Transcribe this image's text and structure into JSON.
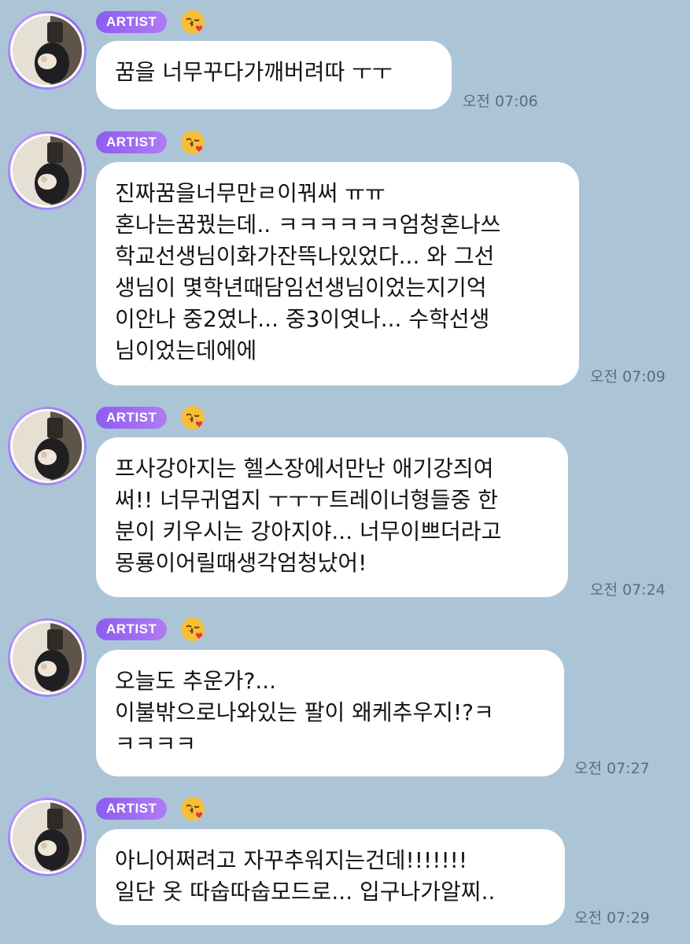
{
  "badge_label": "ARTIST",
  "emoji": "kissing-wink-heart",
  "messages": [
    {
      "text": "꿈을 너무꾸다가깨버려따 ㅜㅜ",
      "time": "오전 07:06"
    },
    {
      "text": "진짜꿈을너무만ㄹ이꿔써 ㅠㅠ\n혼나는꿈꿨는데.. ㅋㅋㅋㅋㅋㅋ엄청혼나쓰\n학교선생님이화가잔뜩나있었다... 와 그선\n생님이 몇학년때담임선생님이었는지기억\n이안나 중2였나... 중3이엿나... 수학선생\n님이었는데에에",
      "time": "오전 07:09"
    },
    {
      "text": "프사강아지는 헬스장에서만난 애기강즤여\n써!! 너무귀엽지 ㅜㅜㅜ트레이너형들중 한\n분이 키우시는 강아지야... 너무이쁘더라고\n몽룡이어릴때생각엄청났어!",
      "time": "오전 07:24"
    },
    {
      "text": "오늘도 추운가?...\n이불밖으로나와있는 팔이 왜케추우지!?ㅋ\nㅋㅋㅋㅋ",
      "time": "오전 07:27"
    },
    {
      "text": "아니어쩌려고 자꾸추워지는건데!!!!!!!\n일단 옷 따숩따숩모드로... 입구나가알찌..",
      "time": "오전 07:29"
    }
  ]
}
